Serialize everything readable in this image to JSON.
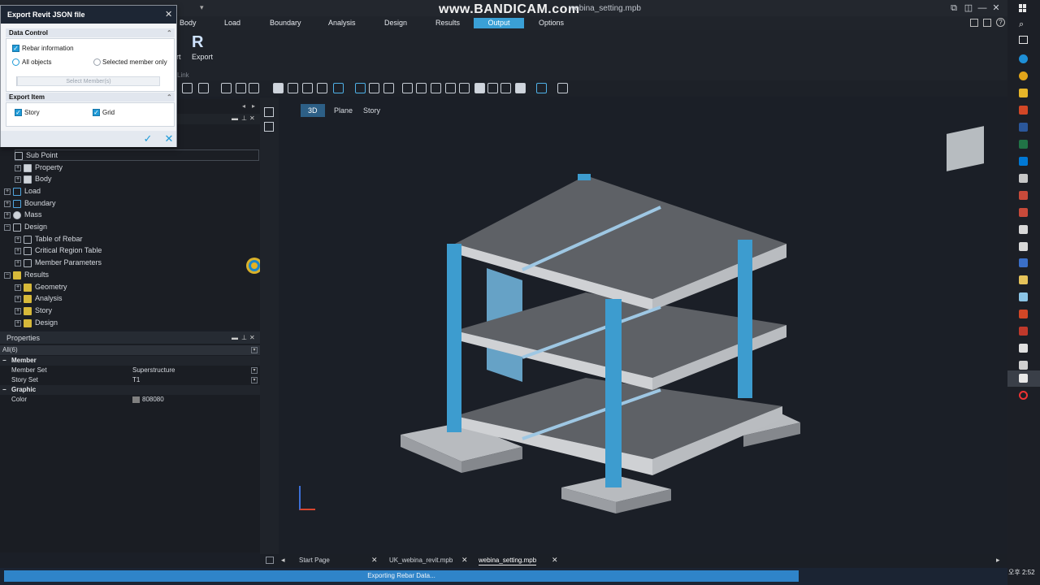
{
  "watermark": {
    "text": "www.BANDICAM.com",
    "file_suffix": "webina_setting.mpb"
  },
  "menubar": {
    "items": [
      "Body",
      "Load",
      "Boundary",
      "Analysis",
      "Design",
      "Results",
      "Output",
      "Options"
    ],
    "active": "Output"
  },
  "ribbon": {
    "export_label": "Export",
    "left_label": "rt",
    "group_label": "Link"
  },
  "dialog": {
    "title": "Export Revit JSON file",
    "data_control": {
      "header": "Data Control",
      "rebar_label": "Rebar information",
      "rebar_checked": true,
      "all_objects_label": "All objects",
      "selected_member_label": "Selected member only",
      "select_member_button": "Select Member(s)"
    },
    "export_item": {
      "header": "Export Item",
      "story_label": "Story",
      "grid_label": "Grid"
    }
  },
  "tree": {
    "items": [
      {
        "label": "Sub Point"
      },
      {
        "label": "Property"
      },
      {
        "label": "Body"
      },
      {
        "label": "Load"
      },
      {
        "label": "Boundary"
      },
      {
        "label": "Mass"
      },
      {
        "label": "Design"
      },
      {
        "label": "Table of Rebar"
      },
      {
        "label": "Critical Region Table"
      },
      {
        "label": "Member Parameters"
      },
      {
        "label": "Results"
      },
      {
        "label": "Geometry"
      },
      {
        "label": "Analysis"
      },
      {
        "label": "Story"
      },
      {
        "label": "Design"
      }
    ]
  },
  "properties": {
    "title": "Properties",
    "filter": "All(6)",
    "member_cat": "Member",
    "graphic_cat": "Graphic",
    "rows": [
      {
        "key": "Member Set",
        "value": "Superstructure"
      },
      {
        "key": "Story Set",
        "value": "T1"
      },
      {
        "key": "Color",
        "value": "808080"
      }
    ]
  },
  "view_tabs": [
    "3D",
    "Plane",
    "Story"
  ],
  "doc_tabs": [
    "Start Page",
    "UK_webina_revit.mpb",
    "webina_setting.mpb"
  ],
  "status": {
    "progress_text": "Exporting Rebar Data...",
    "progress_fraction": 1.0
  },
  "clock": "오후 2:52",
  "colors": {
    "accent": "#3aa0d6",
    "column": "#3d9ccf",
    "slab": "#6b6e73"
  }
}
